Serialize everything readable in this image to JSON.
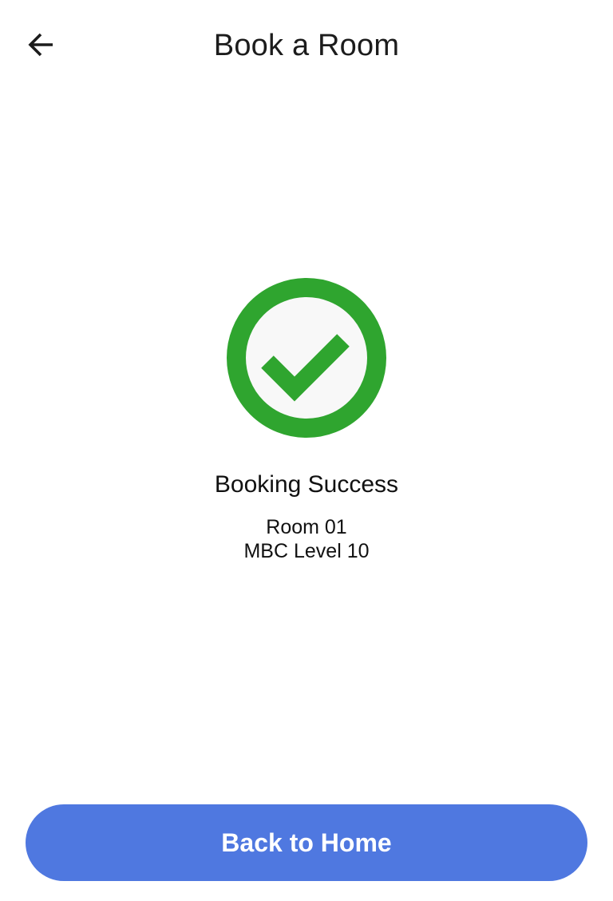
{
  "header": {
    "title": "Book a Room",
    "back_icon": "arrow-left-icon"
  },
  "status": {
    "icon": "check-circle-icon",
    "icon_color": "#2fa52f",
    "title": "Booking Success"
  },
  "room": {
    "name": "Room 01",
    "location": "MBC Level 10"
  },
  "actions": {
    "home_label": "Back to Home",
    "home_color": "#4f78e0"
  }
}
